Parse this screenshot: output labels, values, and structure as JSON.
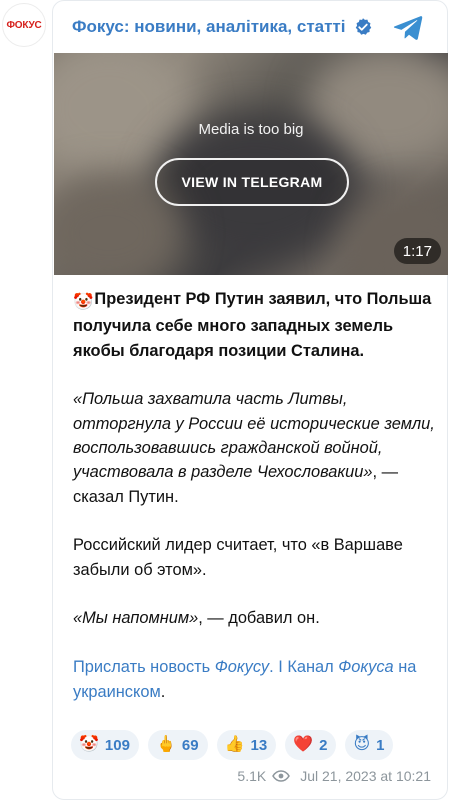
{
  "channel": {
    "avatar_text": "ФОКУС",
    "title": "Фокус: новини, аналітика, статті"
  },
  "media": {
    "notice": "Media is too big",
    "button_label": "VIEW IN TELEGRAM",
    "duration": "1:17"
  },
  "post": {
    "lead_emoji": "🤡",
    "lead_text": "Президент РФ Путин заявил, что Польша получила себе много западных земель якобы благодаря позиции Сталина.",
    "quote": "«Польша захватила часть Литвы, отторгнула у России её исторические земли, воспользовавшись гражданской войной, участвовала в разделе Чехословакии»",
    "quote_tail": ", — сказал Путин.",
    "paragraph2": "Российский лидер считает, что «в Варшаве забыли об этом».",
    "quote2": "«Мы напомним»",
    "quote2_tail": ", — добавил он.",
    "link1_pre": "Прислать новость ",
    "link1_italic": "Фокусу",
    "link1_post": ".",
    "separator": " I ",
    "link2_pre": "Канал ",
    "link2_italic": "Фокуса",
    "link2_post": " на украинском",
    "end_dot": "."
  },
  "reactions": [
    {
      "emoji": "🤡",
      "count": "109"
    },
    {
      "emoji": "🖕",
      "count": "69"
    },
    {
      "emoji": "👍",
      "count": "13"
    },
    {
      "emoji": "❤️",
      "count": "2"
    },
    {
      "emoji": "😈",
      "count": "1"
    }
  ],
  "meta": {
    "views": "5.1K",
    "date": "Jul 21, 2023 at 10:21"
  },
  "colors": {
    "accent": "#3a7cc4",
    "avatar_red": "#d6201c",
    "reaction_bg": "#eef3f8",
    "meta_gray": "#8d969c"
  },
  "icons": [
    "verified-badge-icon",
    "telegram-logo-icon",
    "eye-icon"
  ]
}
